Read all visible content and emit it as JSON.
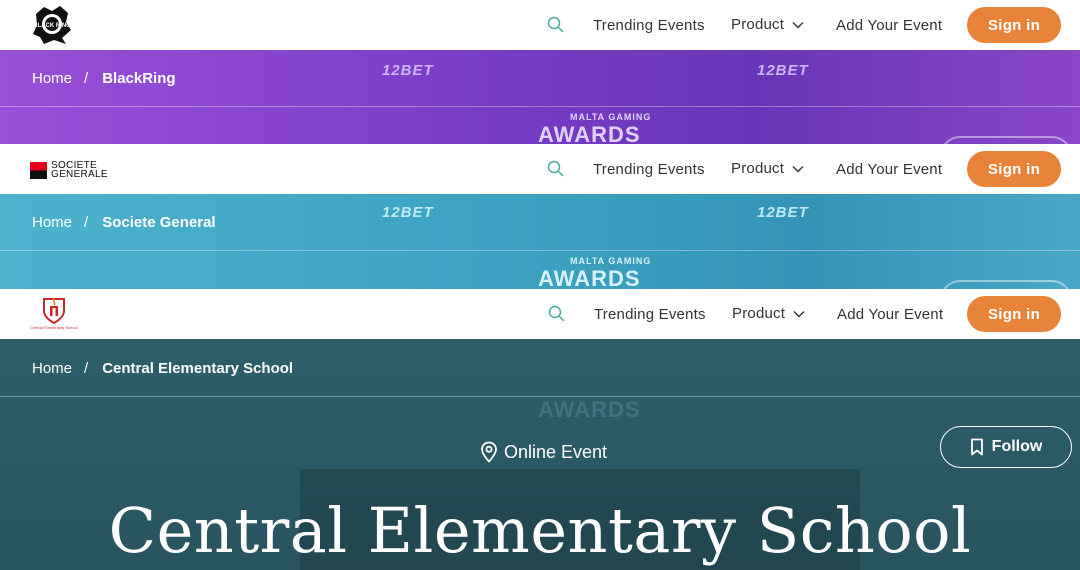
{
  "nav": {
    "links": {
      "trending": "Trending Events",
      "product": "Product",
      "add_event": "Add Your Event"
    },
    "signin_label": "Sign in"
  },
  "brands": [
    {
      "name": "BlackRing",
      "logo_text": "BLACK RING"
    },
    {
      "name": "Societe General",
      "logo_line1": "SOCIETE",
      "logo_line2": "GENERALE"
    },
    {
      "name": "Central Elementary School",
      "logo_caption": "Central Elementary School"
    }
  ],
  "breadcrumb": {
    "home": "Home",
    "separator": "/"
  },
  "stage": {
    "sponsor_logo": "12BET",
    "awards_top": "MALTA GAMING",
    "awards_main": "AWARDS"
  },
  "event": {
    "location": "Online Event",
    "follow_label": "Follow",
    "title": "Central Elementary School"
  },
  "colors": {
    "accent": "#e8833a",
    "banner_purple": "#8a4ad3",
    "banner_teal": "#3c9fbe",
    "banner_dark_teal": "#2a5a66"
  },
  "icons": {
    "search": "search-icon",
    "chevron": "chevron-down-icon",
    "pin": "map-pin-icon",
    "bookmark": "bookmark-icon"
  }
}
